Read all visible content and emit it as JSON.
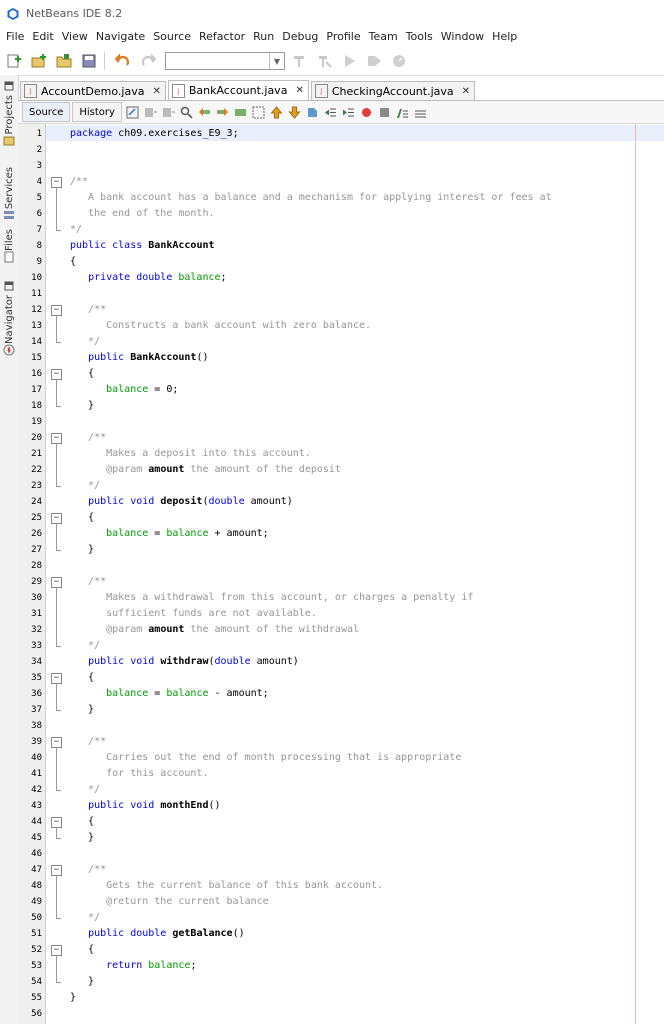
{
  "window": {
    "title": "NetBeans IDE 8.2"
  },
  "menu": [
    "File",
    "Edit",
    "View",
    "Navigate",
    "Source",
    "Refactor",
    "Run",
    "Debug",
    "Profile",
    "Team",
    "Tools",
    "Window",
    "Help"
  ],
  "side_panels": [
    "Projects",
    "Services",
    "Files",
    "Navigator"
  ],
  "tabs": [
    {
      "label": "AccountDemo.java"
    },
    {
      "label": "BankAccount.java"
    },
    {
      "label": "CheckingAccount.java"
    }
  ],
  "editor": {
    "source_label": "Source",
    "history_label": "History"
  },
  "code_lines": [
    [
      [
        "kw",
        "package"
      ],
      [
        "id",
        " ch09.exercises_E9_3;"
      ]
    ],
    [],
    [],
    [
      [
        "cm",
        "/**"
      ]
    ],
    [
      [
        "cm",
        "   A bank account has a balance and a mechanism for applying interest or fees at"
      ]
    ],
    [
      [
        "cm",
        "   the end of the month."
      ]
    ],
    [
      [
        "cm",
        "*/"
      ]
    ],
    [
      [
        "kw",
        "public class "
      ],
      [
        "pn",
        "BankAccount"
      ]
    ],
    [
      [
        "id",
        "{"
      ]
    ],
    [
      [
        "id",
        "   "
      ],
      [
        "kw",
        "private double "
      ],
      [
        "fld",
        "balance"
      ],
      [
        "id",
        ";"
      ]
    ],
    [],
    [
      [
        "cm",
        "   /**"
      ]
    ],
    [
      [
        "cm",
        "      Constructs a bank account with zero balance."
      ]
    ],
    [
      [
        "cm",
        "   */"
      ]
    ],
    [
      [
        "id",
        "   "
      ],
      [
        "kw",
        "public "
      ],
      [
        "pn",
        "BankAccount"
      ],
      [
        "id",
        "()"
      ]
    ],
    [
      [
        "id",
        "   {"
      ]
    ],
    [
      [
        "id",
        "      "
      ],
      [
        "fld",
        "balance"
      ],
      [
        "id",
        " = 0;"
      ]
    ],
    [
      [
        "id",
        "   }"
      ]
    ],
    [],
    [
      [
        "cm",
        "   /**"
      ]
    ],
    [
      [
        "cm",
        "      Makes a deposit into this account."
      ]
    ],
    [
      [
        "cm",
        "      @param "
      ],
      [
        "pn",
        "amount"
      ],
      [
        "cm",
        " the amount of the deposit"
      ]
    ],
    [
      [
        "cm",
        "   */"
      ]
    ],
    [
      [
        "id",
        "   "
      ],
      [
        "kw",
        "public void "
      ],
      [
        "pn",
        "deposit"
      ],
      [
        "id",
        "("
      ],
      [
        "kw",
        "double"
      ],
      [
        "id",
        " amount)"
      ]
    ],
    [
      [
        "id",
        "   {"
      ]
    ],
    [
      [
        "id",
        "      "
      ],
      [
        "fld",
        "balance"
      ],
      [
        "id",
        " = "
      ],
      [
        "fld",
        "balance"
      ],
      [
        "id",
        " + amount;"
      ]
    ],
    [
      [
        "id",
        "   }"
      ]
    ],
    [],
    [
      [
        "cm",
        "   /**"
      ]
    ],
    [
      [
        "cm",
        "      Makes a withdrawal from this account, or charges a penalty if"
      ]
    ],
    [
      [
        "cm",
        "      sufficient funds are not available."
      ]
    ],
    [
      [
        "cm",
        "      @param "
      ],
      [
        "pn",
        "amount"
      ],
      [
        "cm",
        " the amount of the withdrawal"
      ]
    ],
    [
      [
        "cm",
        "   */"
      ]
    ],
    [
      [
        "id",
        "   "
      ],
      [
        "kw",
        "public void "
      ],
      [
        "pn",
        "withdraw"
      ],
      [
        "id",
        "("
      ],
      [
        "kw",
        "double"
      ],
      [
        "id",
        " amount)"
      ]
    ],
    [
      [
        "id",
        "   {"
      ]
    ],
    [
      [
        "id",
        "      "
      ],
      [
        "fld",
        "balance"
      ],
      [
        "id",
        " = "
      ],
      [
        "fld",
        "balance"
      ],
      [
        "id",
        " - amount;"
      ]
    ],
    [
      [
        "id",
        "   }"
      ]
    ],
    [],
    [
      [
        "cm",
        "   /**"
      ]
    ],
    [
      [
        "cm",
        "      Carries out the end of month processing that is appropriate"
      ]
    ],
    [
      [
        "cm",
        "      for this account."
      ]
    ],
    [
      [
        "cm",
        "   */"
      ]
    ],
    [
      [
        "id",
        "   "
      ],
      [
        "kw",
        "public void "
      ],
      [
        "pn",
        "monthEnd"
      ],
      [
        "id",
        "()"
      ]
    ],
    [
      [
        "id",
        "   {"
      ]
    ],
    [
      [
        "id",
        "   }"
      ]
    ],
    [],
    [
      [
        "cm",
        "   /**"
      ]
    ],
    [
      [
        "cm",
        "      Gets the current balance of this bank account."
      ]
    ],
    [
      [
        "cm",
        "      @return the current balance"
      ]
    ],
    [
      [
        "cm",
        "   */"
      ]
    ],
    [
      [
        "id",
        "   "
      ],
      [
        "kw",
        "public double "
      ],
      [
        "pn",
        "getBalance"
      ],
      [
        "id",
        "()"
      ]
    ],
    [
      [
        "id",
        "   {"
      ]
    ],
    [
      [
        "id",
        "      "
      ],
      [
        "kw",
        "return "
      ],
      [
        "fld",
        "balance"
      ],
      [
        "id",
        ";"
      ]
    ],
    [
      [
        "id",
        "   }"
      ]
    ],
    [
      [
        "id",
        "}"
      ]
    ],
    []
  ]
}
